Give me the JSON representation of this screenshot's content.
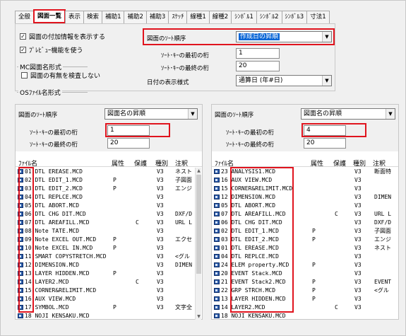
{
  "tabs": [
    "全般",
    "図面一覧",
    "表示",
    "検索",
    "補助1",
    "補助2",
    "補助3",
    "ｽｹｯﾁ",
    "線種1",
    "線種2",
    "ｼﾝﾎﾞﾙ1",
    "ｼﾝﾎﾞﾙ2",
    "ｼﾝﾎﾞﾙ3",
    "寸法1"
  ],
  "top": {
    "show_attached_info": "図面の付加情報を表示する",
    "use_preview": "ﾌﾟﾚﾋﾞｭｰ機能を使う",
    "group_mc": "MC図面名形式",
    "check_existence": "図面の有無を検査しない",
    "group_os": "OSﾌｧｲﾙ名形式",
    "sort_order_label": "図面のｿｰﾄ順序",
    "sort_order_value": "作成日の昇順",
    "sort_key_first_label": "ｿｰﾄ･ｷｰの最初の桁",
    "sort_key_first_value": "1",
    "sort_key_last_label": "ｿｰﾄ･ｷｰの最終の桁",
    "sort_key_last_value": "20",
    "date_format_label": "日付の表示様式",
    "date_format_value": "通算日 (年#日)"
  },
  "left": {
    "sort_order_label": "図面のｿｰﾄ順序",
    "sort_order_value": "図面名の昇順",
    "sort_key_first_label": "ｿｰﾄ･ｷｰの最初の桁",
    "sort_key_first_value": "1",
    "sort_key_last_label": "ｿｰﾄ･ｷｰの最終の桁",
    "sort_key_last_value": "20",
    "columns": [
      "ﾌｧｲﾙ名",
      "属性",
      "保護",
      "種別",
      "注釈"
    ],
    "rows": [
      {
        "name": "01 DTL EREASE.MCD",
        "attr": "",
        "prot": "",
        "kind": "V3",
        "note": "ネスト"
      },
      {
        "name": "02 DTL EDIT_1.MCD",
        "attr": "P",
        "prot": "",
        "kind": "V3",
        "note": "子図面"
      },
      {
        "name": "03 DTL EDIT_2.MCD",
        "attr": "P",
        "prot": "",
        "kind": "V3",
        "note": "エンジ"
      },
      {
        "name": "04 DTL REPLCE.MCD",
        "attr": "",
        "prot": "",
        "kind": "V3",
        "note": ""
      },
      {
        "name": "05 DTL ABORT.MCD",
        "attr": "",
        "prot": "",
        "kind": "V3",
        "note": ""
      },
      {
        "name": "06 DTL CHG DIT.MCD",
        "attr": "",
        "prot": "",
        "kind": "V3",
        "note": "DXF/D"
      },
      {
        "name": "07 DTL AREAFILL.MCD",
        "attr": "",
        "prot": "C",
        "kind": "V3",
        "note": "URL L"
      },
      {
        "name": "08 Note TATE.MCD",
        "attr": "",
        "prot": "",
        "kind": "V3",
        "note": ""
      },
      {
        "name": "09 Note EXCEL OUT.MCD",
        "attr": "P",
        "prot": "",
        "kind": "V3",
        "note": "エクセ"
      },
      {
        "name": "10 Note EXCEL IN.MCD",
        "attr": "P",
        "prot": "",
        "kind": "V3",
        "note": ""
      },
      {
        "name": "11 SMART COPYSTRETCH.MCD",
        "attr": "",
        "prot": "",
        "kind": "V3",
        "note": "<グル"
      },
      {
        "name": "12 DIMENSION.MCD",
        "attr": "",
        "prot": "",
        "kind": "V3",
        "note": "DIMEN"
      },
      {
        "name": "13 LAYER HIDDEN.MCD",
        "attr": "P",
        "prot": "",
        "kind": "V3",
        "note": ""
      },
      {
        "name": "14 LAYER2.MCD",
        "attr": "",
        "prot": "C",
        "kind": "V3",
        "note": ""
      },
      {
        "name": "15 CORNER&RELIMIT.MCD",
        "attr": "",
        "prot": "",
        "kind": "V3",
        "note": ""
      },
      {
        "name": "16 AUX VIEW.MCD",
        "attr": "",
        "prot": "",
        "kind": "V3",
        "note": ""
      },
      {
        "name": "17 SYMBOL.MCD",
        "attr": "P",
        "prot": "",
        "kind": "V3",
        "note": "文字全"
      },
      {
        "name": "18 NOJI KENSAKU.MCD",
        "attr": "",
        "prot": "",
        "kind": "",
        "note": ""
      }
    ]
  },
  "right": {
    "sort_order_label": "図面のｿｰﾄ順序",
    "sort_order_value": "図面名の昇順",
    "sort_key_first_label": "ｿｰﾄ･ｷｰの最初の桁",
    "sort_key_first_value": "4",
    "sort_key_last_label": "ｿｰﾄ･ｷｰの最終の桁",
    "sort_key_last_value": "20",
    "columns": [
      "ﾌｧｲﾙ名",
      "属性",
      "保護",
      "種別",
      "注釈"
    ],
    "rows": [
      {
        "name": "23 ANALYSIS1.MCD",
        "attr": "",
        "prot": "",
        "kind": "V3",
        "note": "断面特"
      },
      {
        "name": "16 AUX VIEW.MCD",
        "attr": "",
        "prot": "",
        "kind": "V3",
        "note": ""
      },
      {
        "name": "15 CORNER&RELIMIT.MCD",
        "attr": "",
        "prot": "",
        "kind": "V3",
        "note": ""
      },
      {
        "name": "12 DIMENSION.MCD",
        "attr": "",
        "prot": "",
        "kind": "V3",
        "note": "DIMEN"
      },
      {
        "name": "05 DTL ABORT.MCD",
        "attr": "",
        "prot": "",
        "kind": "V3",
        "note": ""
      },
      {
        "name": "07 DTL AREAFILL.MCD",
        "attr": "",
        "prot": "C",
        "kind": "V3",
        "note": "URL L"
      },
      {
        "name": "06 DTL CHG DIT.MCD",
        "attr": "",
        "prot": "",
        "kind": "V3",
        "note": "DXF/D"
      },
      {
        "name": "02 DTL EDIT_1.MCD",
        "attr": "P",
        "prot": "",
        "kind": "V3",
        "note": "子図面"
      },
      {
        "name": "03 DTL EDIT_2.MCD",
        "attr": "P",
        "prot": "",
        "kind": "V3",
        "note": "エンジ"
      },
      {
        "name": "01 DTL EREASE.MCD",
        "attr": "",
        "prot": "",
        "kind": "V3",
        "note": "ネスト"
      },
      {
        "name": "04 DTL REPLCE.MCD",
        "attr": "",
        "prot": "",
        "kind": "V3",
        "note": ""
      },
      {
        "name": "24 ELEM property.MCD",
        "attr": "P",
        "prot": "",
        "kind": "V3",
        "note": ""
      },
      {
        "name": "20 EVENT Stack.MCD",
        "attr": "",
        "prot": "",
        "kind": "V3",
        "note": ""
      },
      {
        "name": "21 EVENT Stack2.MCD",
        "attr": "P",
        "prot": "",
        "kind": "V3",
        "note": "EVENT"
      },
      {
        "name": "22 GRP STRCH.MCD",
        "attr": "P",
        "prot": "",
        "kind": "V3",
        "note": "<グル"
      },
      {
        "name": "13 LAYER HIDDEN.MCD",
        "attr": "P",
        "prot": "",
        "kind": "V3",
        "note": ""
      },
      {
        "name": "14 LAYER2.MCD",
        "attr": "",
        "prot": "C",
        "kind": "V3",
        "note": ""
      },
      {
        "name": "18 NOJI KENSAKU.MCD",
        "attr": "",
        "prot": "",
        "kind": "",
        "note": ""
      }
    ]
  }
}
